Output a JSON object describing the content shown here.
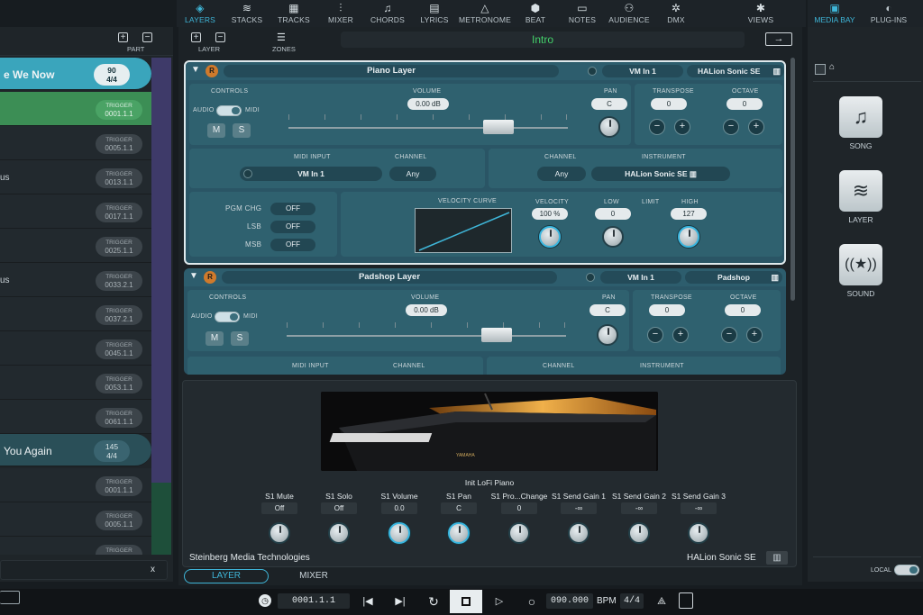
{
  "topnav": {
    "items": [
      {
        "label": "LAYERS",
        "icon": "layers-icon",
        "glyph": "◈"
      },
      {
        "label": "STACKS",
        "icon": "stacks-icon",
        "glyph": "≋"
      },
      {
        "label": "TRACKS",
        "icon": "tracks-icon",
        "glyph": "▦"
      },
      {
        "label": "MIXER",
        "icon": "mixer-icon",
        "glyph": "⫶"
      },
      {
        "label": "CHORDS",
        "icon": "chords-icon",
        "glyph": "♫"
      },
      {
        "label": "LYRICS",
        "icon": "lyrics-icon",
        "glyph": "▤"
      },
      {
        "label": "METRONOME",
        "icon": "metronome-icon",
        "glyph": "△"
      },
      {
        "label": "BEAT",
        "icon": "beat-icon",
        "glyph": "⬢"
      },
      {
        "label": "NOTES",
        "icon": "notes-icon",
        "glyph": "▭"
      },
      {
        "label": "AUDIENCE",
        "icon": "audience-icon",
        "glyph": "⚇"
      },
      {
        "label": "DMX",
        "icon": "dmx-icon",
        "glyph": "✲"
      },
      {
        "label": "VIEWS",
        "icon": "views-icon",
        "glyph": "✱"
      }
    ],
    "active": "LAYERS"
  },
  "rightnav": {
    "media_bay": "MEDIA BAY",
    "plugins": "PLUG-INS"
  },
  "left": {
    "part_label": "PART",
    "add": "+",
    "remove": "−",
    "song1": {
      "title": "e We Now",
      "bpm": "90",
      "sig": "4/4"
    },
    "song2": {
      "title": "You Again",
      "bpm": "145",
      "sig": "4/4"
    },
    "trigger": "TRIGGER",
    "triggers": [
      "0001.1.1",
      "0005.1.1",
      "0013.1.1",
      "0017.1.1",
      "0025.1.1",
      "0033.2.1",
      "0037.2.1",
      "0045.1.1",
      "0053.1.1",
      "0061.1.1",
      "0001.1.1",
      "0005.1.1"
    ],
    "part_labels": [
      "us",
      "us"
    ],
    "close": "x"
  },
  "center": {
    "layer_label": "LAYER",
    "zones_label": "ZONES",
    "part_name": "Intro",
    "arrow": "→"
  },
  "layers": [
    {
      "name": "Piano Layer",
      "midi_in": "VM In 1",
      "instrument": "HALion Sonic SE",
      "controls": "CONTROLS",
      "audio": "AUDIO",
      "midi": "MIDI",
      "m": "M",
      "s": "S",
      "volume_label": "VOLUME",
      "volume": "0.00 dB",
      "pan_label": "PAN",
      "pan": "C",
      "transpose_label": "TRANSPOSE",
      "transpose": "0",
      "octave_label": "OCTAVE",
      "octave": "0",
      "midi_input_label": "MIDI INPUT",
      "channel_label": "CHANNEL",
      "channel": "Any",
      "channel2_label": "CHANNEL",
      "channel2": "Any",
      "instrument_label": "INSTRUMENT",
      "pgm_label": "PGM CHG",
      "pgm": "OFF",
      "lsb_label": "LSB",
      "lsb": "OFF",
      "msb_label": "MSB",
      "msb": "OFF",
      "velocity_curve_label": "VELOCITY CURVE",
      "velocity_label": "VELOCITY",
      "velocity": "100 %",
      "low_label": "LOW",
      "low": "0",
      "limit_label": "LIMIT",
      "high_label": "HIGH",
      "high": "127"
    },
    {
      "name": "Padshop Layer",
      "midi_in": "VM In 1",
      "instrument": "Padshop",
      "controls": "CONTROLS",
      "audio": "AUDIO",
      "midi": "MIDI",
      "m": "M",
      "s": "S",
      "volume_label": "VOLUME",
      "volume": "0.00 dB",
      "pan_label": "PAN",
      "pan": "C",
      "transpose_label": "TRANSPOSE",
      "transpose": "0",
      "octave_label": "OCTAVE",
      "octave": "0",
      "midi_input_label": "MIDI INPUT",
      "channel_label": "CHANNEL",
      "channel2_label": "CHANNEL",
      "instrument_label": "INSTRUMENT"
    }
  ],
  "instrument": {
    "preset": "Init LoFi Piano",
    "brand": "YAMAHA",
    "vendor": "Steinberg Media Technologies",
    "plugin": "HALion Sonic SE",
    "params": [
      {
        "label": "S1 Mute",
        "value": "Off"
      },
      {
        "label": "S1 Solo",
        "value": "Off"
      },
      {
        "label": "S1 Volume",
        "value": "0.0"
      },
      {
        "label": "S1 Pan",
        "value": "C"
      },
      {
        "label": "S1 Pro...Change",
        "value": "0"
      },
      {
        "label": "S1 Send Gain 1",
        "value": "-∞"
      },
      {
        "label": "S1 Send Gain 2",
        "value": "-∞"
      },
      {
        "label": "S1 Send Gain 3",
        "value": "-∞"
      }
    ]
  },
  "bottomtabs": {
    "layer": "LAYER",
    "mixer": "MIXER"
  },
  "mediabay": {
    "song": "SONG",
    "layer": "LAYER",
    "sound": "SOUND",
    "local": "LOCAL"
  },
  "transport": {
    "position": "0001.1.1",
    "tempo": "090.000",
    "bpm_label": "BPM",
    "signature": "4/4"
  }
}
